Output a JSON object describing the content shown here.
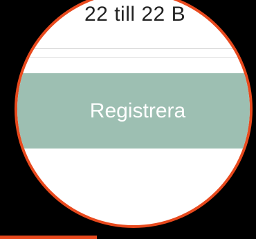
{
  "form": {
    "partial_text": "22 till 22 B",
    "register_button_label": "Registrera"
  },
  "colors": {
    "background": "#000000",
    "highlight_ring": "#e8491d",
    "button_bg": "#9dbfb2",
    "button_text": "#ffffff"
  }
}
